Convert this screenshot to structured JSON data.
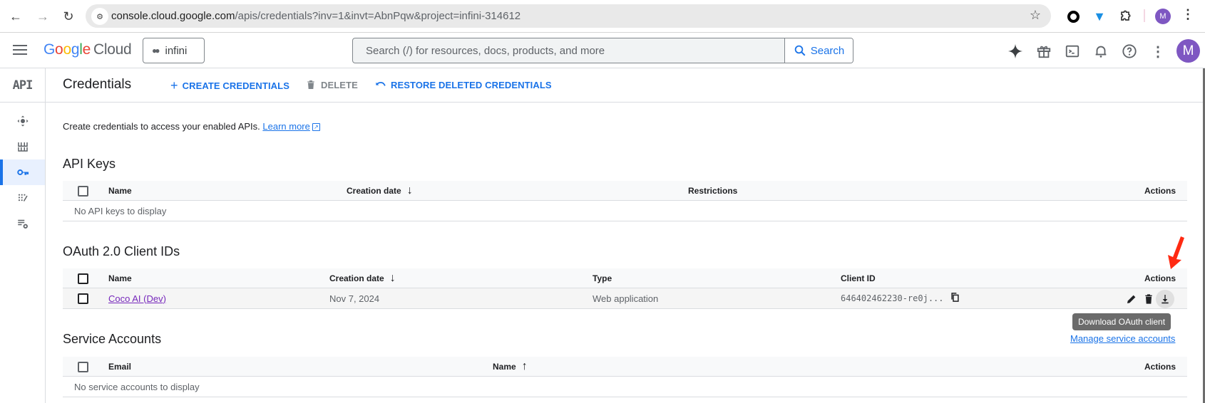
{
  "browser": {
    "url_host": "console.cloud.google.com",
    "url_path": "/apis/credentials?inv=1&invt=AbnPqw&project=infini-314612",
    "profile_initial": "M"
  },
  "header": {
    "logo_google": [
      "G",
      "o",
      "o",
      "g",
      "l",
      "e"
    ],
    "logo_cloud": "Cloud",
    "project_name": "infini",
    "search_placeholder": "Search (/) for resources, docs, products, and more",
    "search_button": "Search",
    "avatar_initial": "M"
  },
  "sidebar": {
    "product_label": "API",
    "items": [
      {
        "name": "enabled-apis",
        "icon": "apis-icon",
        "active": false
      },
      {
        "name": "library",
        "icon": "library-icon",
        "active": false
      },
      {
        "name": "credentials",
        "icon": "key-icon",
        "active": true
      },
      {
        "name": "oauth-consent",
        "icon": "consent-icon",
        "active": false
      },
      {
        "name": "page-usage-agreements",
        "icon": "settings-list-icon",
        "active": false
      }
    ]
  },
  "toolbar": {
    "title": "Credentials",
    "create_label": "CREATE CREDENTIALS",
    "delete_label": "DELETE",
    "restore_label": "RESTORE DELETED CREDENTIALS"
  },
  "intro": {
    "text": "Create credentials to access your enabled APIs.",
    "link": "Learn more"
  },
  "api_keys": {
    "title": "API Keys",
    "columns": [
      "Name",
      "Creation date",
      "Restrictions",
      "Actions"
    ],
    "empty_text": "No API keys to display"
  },
  "oauth": {
    "title": "OAuth 2.0 Client IDs",
    "columns": [
      "Name",
      "Creation date",
      "Type",
      "Client ID",
      "Actions"
    ],
    "rows": [
      {
        "name": "Coco AI (Dev)",
        "created": "Nov 7, 2024",
        "type": "Web application",
        "client_id": "646402462230-re0j..."
      }
    ],
    "tooltip": "Download OAuth client"
  },
  "service_accounts": {
    "title": "Service Accounts",
    "manage_link": "Manage service accounts",
    "columns": [
      "Email",
      "Name",
      "Actions"
    ],
    "empty_text": "No service accounts to display"
  },
  "colors": {
    "accent": "#1a73e8",
    "visited_link": "#7627bb",
    "annotation_arrow": "#ff2a12",
    "avatar": "#7e57c2"
  }
}
